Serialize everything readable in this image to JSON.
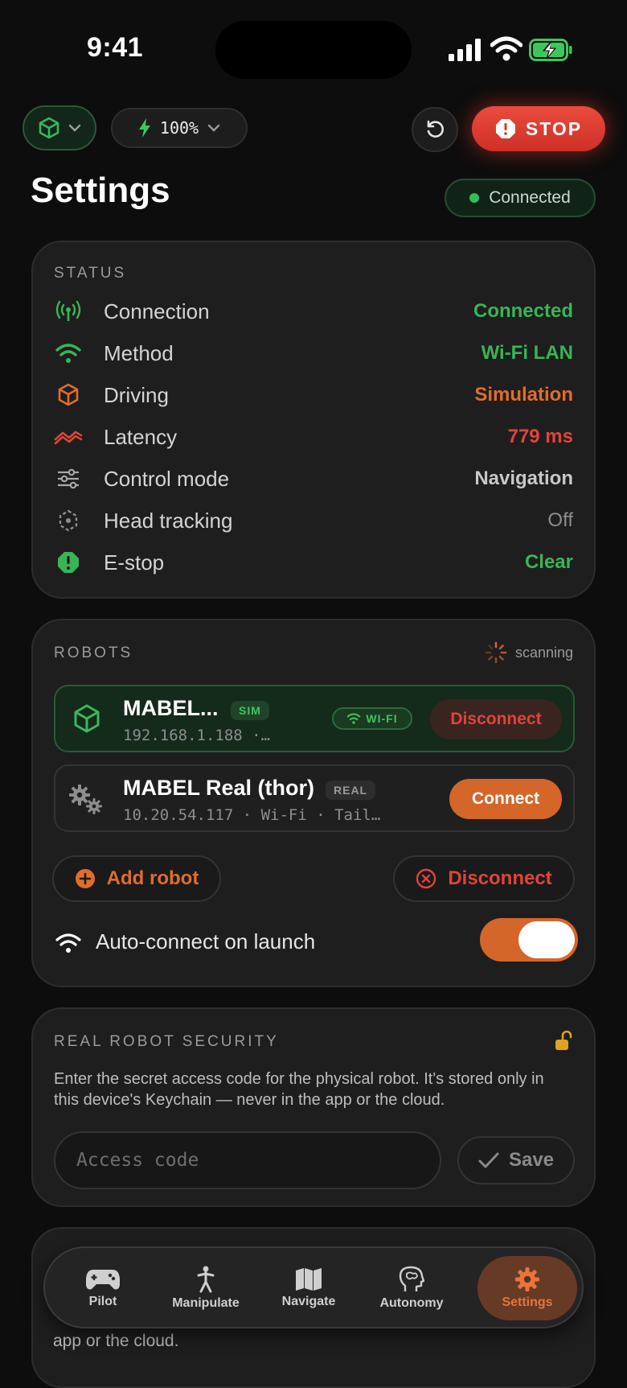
{
  "status_bar": {
    "time": "9:41"
  },
  "top": {
    "power_value": "100%",
    "stop_label": "STOP"
  },
  "page": {
    "title": "Settings",
    "connection_badge": "Connected"
  },
  "status_card": {
    "heading": "STATUS",
    "rows": [
      {
        "label": "Connection",
        "value": "Connected",
        "color": "#38b556",
        "icon": "antenna-icon"
      },
      {
        "label": "Method",
        "value": "Wi-Fi LAN",
        "color": "#38b556",
        "icon": "wifi-icon"
      },
      {
        "label": "Driving",
        "value": "Simulation",
        "color": "#e06d2c",
        "icon": "cube-icon"
      },
      {
        "label": "Latency",
        "value": "779 ms",
        "color": "#e0443a",
        "icon": "latency-icon"
      },
      {
        "label": "Control mode",
        "value": "Navigation",
        "color": "#c8c8c8",
        "icon": "sliders-icon"
      },
      {
        "label": "Head tracking",
        "value": "Off",
        "color": "#8e8e8e",
        "icon": "head-tracking-icon"
      },
      {
        "label": "E-stop",
        "value": "Clear",
        "color": "#38b556",
        "icon": "estop-icon"
      }
    ]
  },
  "robots_card": {
    "heading": "ROBOTS",
    "scanning": "scanning",
    "robots": [
      {
        "name": "MABEL...",
        "tag": "SIM",
        "address": "192.168.1.188 ·…",
        "net_tag": "WI-FI",
        "action": "Disconnect"
      },
      {
        "name": "MABEL Real (thor)",
        "tag": "REAL",
        "address": "10.20.54.117 · Wi-Fi · Tail…",
        "action": "Connect"
      }
    ],
    "add_robot": "Add robot",
    "disconnect": "Disconnect",
    "auto_connect": "Auto-connect on launch"
  },
  "security_card": {
    "heading": "REAL ROBOT SECURITY",
    "description": "Enter the secret access code for the physical robot. It's stored only in this device's Keychain — never in the app or the cloud.",
    "placeholder": "Access code",
    "save": "Save"
  },
  "next_card_peek": {
    "text": "app or the cloud."
  },
  "tabs": [
    {
      "label": "Pilot",
      "icon": "gamepad-icon"
    },
    {
      "label": "Manipulate",
      "icon": "person-icon"
    },
    {
      "label": "Navigate",
      "icon": "map-icon"
    },
    {
      "label": "Autonomy",
      "icon": "brain-icon"
    },
    {
      "label": "Settings",
      "icon": "gear-icon"
    }
  ]
}
